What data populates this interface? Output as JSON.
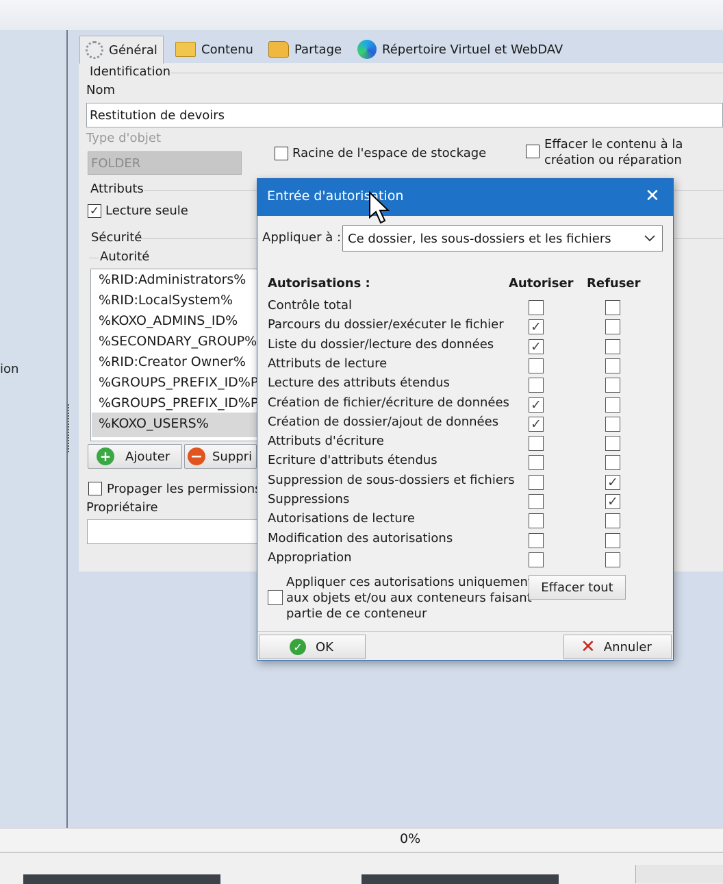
{
  "tabs": [
    {
      "label": "Général",
      "icon": "gear-icon"
    },
    {
      "label": "Contenu",
      "icon": "folder-icon"
    },
    {
      "label": "Partage",
      "icon": "share-folder-icon"
    },
    {
      "label": "Répertoire Virtuel et WebDAV",
      "icon": "edge-icon"
    }
  ],
  "left_label": "ion",
  "identification": {
    "section_label": "Identification",
    "name_label": "Nom",
    "name_value": "Restitution de devoirs",
    "type_label": "Type d'objet",
    "type_value": "FOLDER",
    "root_label": "Racine de l'espace de stockage",
    "root_checked": false,
    "erase_label_1": "Effacer le contenu à la",
    "erase_label_2": "création ou réparation",
    "erase_checked": false
  },
  "attributes": {
    "section_label": "Attributs",
    "readonly_label": "Lecture seule",
    "readonly_checked": true
  },
  "security": {
    "section_label": "Sécurité",
    "authority_label": "Autorité",
    "authorities": [
      "%RID:Administrators%",
      "%RID:LocalSystem%",
      "%KOXO_ADMINS_ID%",
      "%SECONDARY_GROUP%",
      "%RID:Creator Owner%",
      "%GROUPS_PREFIX_ID%P",
      "%GROUPS_PREFIX_ID%P",
      "%KOXO_USERS%"
    ],
    "add_label": "Ajouter",
    "remove_label": "Suppri",
    "propagate_label": "Propager les permissions c",
    "propagate_checked": false,
    "owner_label": "Propriétaire",
    "owner_value": ""
  },
  "status": {
    "progress_text": "0%"
  },
  "dialog": {
    "title": "Entrée d'autorisation",
    "close_glyph": "✕",
    "apply_label": "Appliquer à :",
    "apply_value": "Ce dossier, les sous-dossiers et les fichiers",
    "permissions_header": "Autorisations :",
    "allow_header": "Autoriser",
    "deny_header": "Refuser",
    "permissions": [
      {
        "label": "Contrôle total",
        "allow": false,
        "deny": false
      },
      {
        "label": "Parcours du dossier/exécuter le fichier",
        "allow": true,
        "deny": false
      },
      {
        "label": "Liste du dossier/lecture des données",
        "allow": true,
        "deny": false
      },
      {
        "label": "Attributs de lecture",
        "allow": false,
        "deny": false
      },
      {
        "label": "Lecture des attributs étendus",
        "allow": false,
        "deny": false
      },
      {
        "label": "Création de fichier/écriture de données",
        "allow": true,
        "deny": false
      },
      {
        "label": "Création de dossier/ajout de données",
        "allow": true,
        "deny": false
      },
      {
        "label": "Attributs d'écriture",
        "allow": false,
        "deny": false
      },
      {
        "label": "Ecriture d'attributs étendus",
        "allow": false,
        "deny": false
      },
      {
        "label": "Suppression de sous-dossiers et fichiers",
        "allow": false,
        "deny": true
      },
      {
        "label": "Suppressions",
        "allow": false,
        "deny": true
      },
      {
        "label": "Autorisations de lecture",
        "allow": false,
        "deny": false
      },
      {
        "label": "Modification des autorisations",
        "allow": false,
        "deny": false
      },
      {
        "label": "Appropriation",
        "allow": false,
        "deny": false
      }
    ],
    "apply_only_lines": [
      "Appliquer ces autorisations uniquement",
      "aux objets et/ou aux conteneurs faisant",
      "partie de ce conteneur"
    ],
    "apply_only_checked": false,
    "clear_all_label": "Effacer tout",
    "ok_label": "OK",
    "cancel_label": "Annuler",
    "title_bar_color": "#1e73c8"
  }
}
